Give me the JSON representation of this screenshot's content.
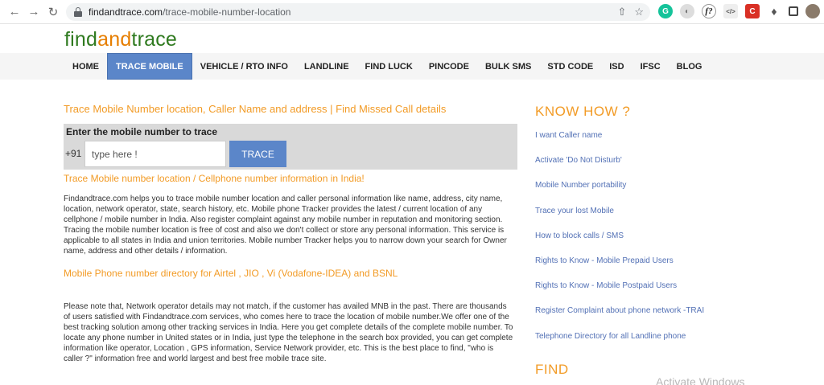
{
  "browser": {
    "url_domain": "findandtrace.com",
    "url_path": "/trace-mobile-number-location"
  },
  "site": {
    "logo": {
      "find": "find",
      "and": "and",
      "trace": "trace"
    },
    "menu": [
      {
        "label": "HOME",
        "active": false
      },
      {
        "label": "TRACE MOBILE",
        "active": true
      },
      {
        "label": "VEHICLE / RTO INFO",
        "active": false
      },
      {
        "label": "LANDLINE",
        "active": false
      },
      {
        "label": "FIND LUCK",
        "active": false
      },
      {
        "label": "PINCODE",
        "active": false
      },
      {
        "label": "BULK SMS",
        "active": false
      },
      {
        "label": "STD CODE",
        "active": false
      },
      {
        "label": "ISD",
        "active": false
      },
      {
        "label": "IFSC",
        "active": false
      },
      {
        "label": "BLOG",
        "active": false
      }
    ]
  },
  "main": {
    "title": "Trace Mobile Number location, Caller Name and address | Find Missed Call details",
    "search": {
      "label": "Enter the mobile number to trace",
      "prefix": "+91",
      "placeholder": "type here !",
      "button": "TRACE"
    },
    "subtitle": "Trace Mobile number location / Cellphone number information in India!",
    "para1": "Findandtrace.com helps you to trace mobile number location and caller personal information like name, address, city name, location, network operator, state, search history, etc. Mobile phone Tracker provides the latest / current location of any cellphone / mobile number in India. Also register complaint against any mobile number in reputation and monitoring section. Tracing the mobile number location is free of cost and also we don't collect or store any personal information. This service is applicable to all states in India and union territories. Mobile number Tracker helps you to narrow down your search for Owner name, address and other details / information.",
    "directory_title": "Mobile Phone number directory for Airtel , JIO , Vi (Vodafone-IDEA) and BSNL",
    "para2": "Please note that, Network operator details may not match, if the customer has availed MNB in the past. There are thousands of users satisfied with Findandtrace.com services, who comes here to trace the location of mobile number.We offer one of the best tracking solution among other tracking services in India. Here you get complete details of the complete mobile number. To locate any phone number in United states or in India, just type the telephone in the search box provided, you can get complete information like operator, Location , GPS information, Service Network provider, etc. This is the best place to find, \"who is caller ?\" information free and world largest and best free mobile trace site."
  },
  "sidebar": {
    "know_title": "KNOW HOW ?",
    "links": [
      "I want Caller name",
      "Activate 'Do Not Disturb'",
      "Mobile Number portability",
      "Trace your lost Mobile",
      "How to block calls / SMS",
      "Rights to Know - Mobile Prepaid Users",
      "Rights to Know - Mobile Postpaid Users",
      "Register Complaint about phone network -TRAI",
      "Telephone Directory for all Landline phone"
    ],
    "find_title": "FIND"
  },
  "watermark": "Activate Windows",
  "colors": {
    "accent_orange": "#f29b26",
    "nav_blue": "#5b86c9",
    "link_blue": "#5270b5",
    "logo_green": "#2f7a1f"
  }
}
